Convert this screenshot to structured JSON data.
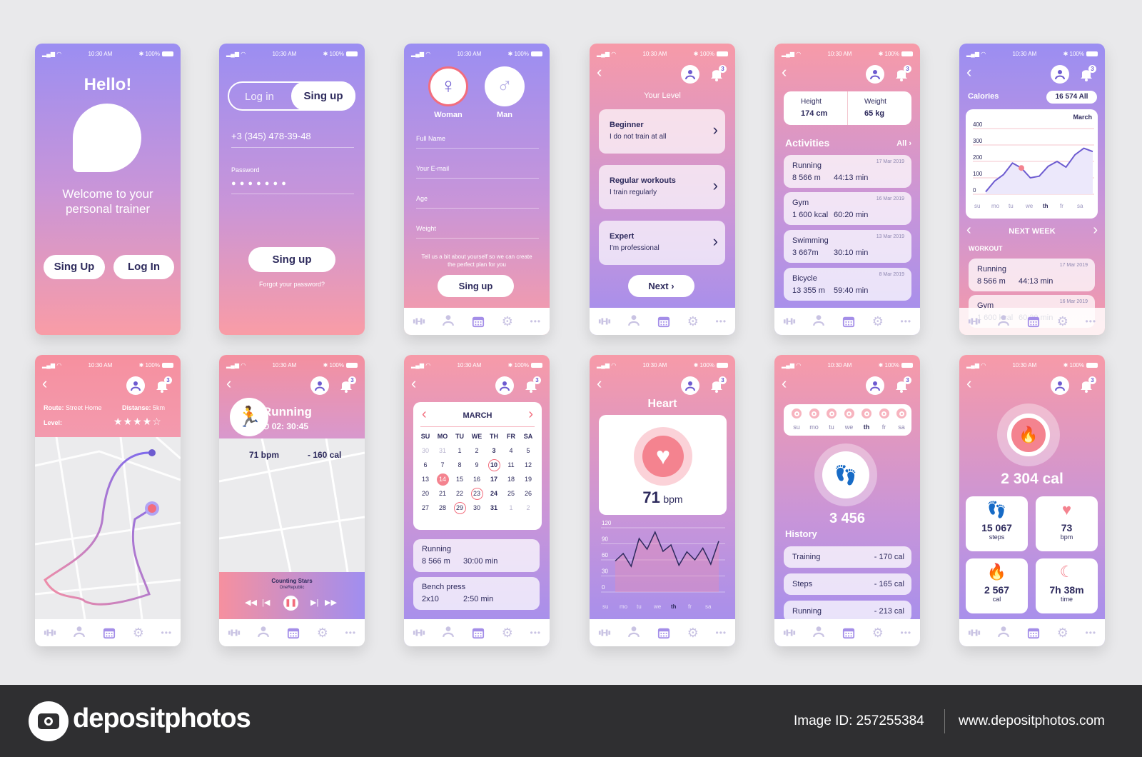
{
  "status": {
    "time": "10:30 AM",
    "battery": "✱ 100%"
  },
  "header": {
    "badge": "3"
  },
  "colors": {
    "pink": "#f69aa9",
    "purple": "#9c8ef2",
    "navy": "#2d2a5c",
    "accent": "#f26d7d",
    "violet": "#6d5bd0"
  },
  "s1": {
    "title": "Hello!",
    "welcome": "Welcome to your personal trainer",
    "signup": "Sing Up",
    "login": "Log In"
  },
  "s2": {
    "tab_login": "Log in",
    "tab_signup": "Sing up",
    "phone": "+3 (345) 478-39-48",
    "password_label": "Password",
    "password_dots": "● ● ● ● ● ● ●",
    "signup": "Sing up",
    "forgot": "Forgot your password?"
  },
  "s3": {
    "woman": "Woman",
    "man": "Man",
    "fields": [
      "Full Name",
      "Your E-mail",
      "Age",
      "Weight"
    ],
    "hint": "Tell us a bit about yourself so we can create  the perfect plan for you",
    "signup": "Sing up"
  },
  "s4": {
    "title": "Your Level",
    "levels": [
      {
        "name": "Beginner",
        "desc": "I do not train at all"
      },
      {
        "name": "Regular workouts",
        "desc": "I train regularly"
      },
      {
        "name": "Expert",
        "desc": "I'm professional"
      }
    ],
    "next": "Next"
  },
  "s5": {
    "height_label": "Height",
    "height": "174 cm",
    "weight_label": "Weight",
    "weight": "65 kg",
    "activities": "Activities",
    "all": "All",
    "items": [
      {
        "name": "Running",
        "date": "17 Mar 2019",
        "v1": "8 566 m",
        "v2": "44:13 min"
      },
      {
        "name": "Gym",
        "date": "16 Mar 2019",
        "v1": "1 600 kcal",
        "v2": "60:20 min"
      },
      {
        "name": "Swimming",
        "date": "13 Mar 2019",
        "v1": "3 667m",
        "v2": "30:10 min"
      },
      {
        "name": "Bicycle",
        "date": "8 Mar 2019",
        "v1": "13 355 m",
        "v2": "59:40 min"
      }
    ]
  },
  "s6": {
    "calories": "Calories",
    "total": "16 574 All",
    "month": "March",
    "yticks": [
      "400",
      "300",
      "200",
      "100",
      "0"
    ],
    "days": [
      "su",
      "mo",
      "tu",
      "we",
      "th",
      "fr",
      "sa"
    ],
    "active_day": "th",
    "series": [
      15,
      80,
      120,
      190,
      160,
      100,
      110,
      170,
      200,
      165,
      240,
      280,
      260
    ],
    "next_week": "NEXT WEEK",
    "workout": "WORKOUT",
    "items": [
      {
        "name": "Running",
        "date": "17 Mar 2019",
        "v1": "8 566 m",
        "v2": "44:13 min"
      },
      {
        "name": "Gym",
        "date": "16 Mar 2019",
        "v1": "1 600 kcal",
        "v2": "60:20 min"
      }
    ]
  },
  "r1": {
    "route_label": "Route:",
    "route": "Street Home",
    "distance_label": "Distanse:",
    "distance": "5km",
    "level_label": "Level:",
    "stars": 4,
    "stars_max": 5
  },
  "r2": {
    "title": "Running",
    "time": "02: 30:45",
    "bpm": "71 bpm",
    "cal": "- 160 cal",
    "song": "Counting Stars",
    "artist": "OneRepublic"
  },
  "r3": {
    "month": "MARCH",
    "weekdays": [
      "SU",
      "MO",
      "TU",
      "WE",
      "TH",
      "FR",
      "SA"
    ],
    "weeks": [
      [
        "30",
        "31",
        "1",
        "2",
        "3",
        "4",
        "5"
      ],
      [
        "6",
        "7",
        "8",
        "9",
        "10",
        "11",
        "12"
      ],
      [
        "13",
        "14",
        "15",
        "16",
        "17",
        "18",
        "19"
      ],
      [
        "20",
        "21",
        "22",
        "23",
        "24",
        "25",
        "26"
      ],
      [
        "27",
        "28",
        "29",
        "30",
        "31",
        "1",
        "2"
      ]
    ],
    "selected": "14",
    "circled": [
      "10",
      "23",
      "29"
    ],
    "items": [
      {
        "name": "Running",
        "v1": "8 566 m",
        "v2": "30:00 min"
      },
      {
        "name": "Bench press",
        "v1": "2x10",
        "v2": "2:50 min"
      }
    ]
  },
  "r4": {
    "title": "Heart",
    "value": "71",
    "unit": "bpm",
    "yticks": [
      "120",
      "90",
      "60",
      "30",
      "0"
    ],
    "days": [
      "su",
      "mo",
      "tu",
      "we",
      "th",
      "fr",
      "sa"
    ],
    "active_day": "th",
    "series": [
      58,
      72,
      48,
      100,
      80,
      112,
      76,
      88,
      50,
      75,
      60,
      82,
      52,
      95
    ]
  },
  "r5": {
    "days": [
      "su",
      "mo",
      "tu",
      "we",
      "th",
      "fr",
      "sa"
    ],
    "active_day": "th",
    "steps": "3 456",
    "history": "History",
    "items": [
      {
        "name": "Training",
        "value": "- 170 cal"
      },
      {
        "name": "Steps",
        "value": "- 165 cal"
      },
      {
        "name": "Running",
        "value": "- 213 cal"
      }
    ]
  },
  "r6": {
    "total": "2 304 cal",
    "tiles": [
      {
        "value": "15 067",
        "label": "steps"
      },
      {
        "value": "73",
        "label": "bpm"
      },
      {
        "value": "2 567",
        "label": "cal"
      },
      {
        "value": "7h 38m",
        "label": "time"
      }
    ]
  },
  "footer": {
    "brand": "depositphotos",
    "image_id": "Image ID: 257255384",
    "url": "www.depositphotos.com"
  }
}
